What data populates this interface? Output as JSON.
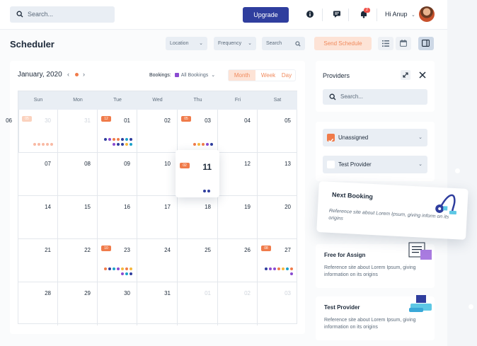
{
  "topbar": {
    "search_placeholder": "Search...",
    "upgrade_label": "Upgrade",
    "notification_count": "2",
    "greeting": "Hi Anup"
  },
  "page": {
    "title": "Scheduler",
    "filters": {
      "location": "Location",
      "frequency": "Frequency",
      "search": "Search"
    },
    "send_schedule_label": "Send Schedule"
  },
  "calendar": {
    "month_label": "January, 2020",
    "prev_icon": "chevron-left-icon",
    "next_icon": "chevron-right-icon",
    "bookings_label": "Bookings:",
    "bookings_value": "All Bookings",
    "view_tabs": [
      "Month",
      "Week",
      "Day"
    ],
    "active_view": "Month",
    "weekdays": [
      "Sun",
      "Mon",
      "Tue",
      "Wed",
      "Thu",
      "Fri",
      "Sat"
    ],
    "weeks": [
      [
        {
          "day": "30",
          "dim": true,
          "badge": "05",
          "dots": [
            "#f9b9a4",
            "#f9b9a4",
            "#f9b9a4",
            "#f9b9a4",
            "#f9b9a4"
          ]
        },
        {
          "day": "31",
          "dim": true
        },
        {
          "day": "01",
          "badge": "12",
          "dots": [
            "#2f3e9e",
            "#8a4bd1",
            "#f07b4a",
            "#f07b4a",
            "#2f3e9e",
            "#1aa1c9",
            "#2f3e9e",
            "#8a4bd1",
            "#2f3e9e",
            "#2f3e9e",
            "#f6b73c",
            "#1aa1c9"
          ]
        },
        {
          "day": "02"
        },
        {
          "day": "03",
          "badge": "05",
          "dots": [
            "#f07b4a",
            "#f6b73c",
            "#f07b4a",
            "#8a4bd1",
            "#2f3e9e"
          ]
        },
        {
          "day": "04"
        },
        {
          "day": "05"
        },
        {
          "day": "06"
        }
      ],
      [
        {
          "day": "07"
        },
        {
          "day": "08"
        },
        {
          "day": "09"
        },
        {
          "day": "10"
        },
        {
          "day": "11",
          "badge": "02",
          "dots": [
            "#2f3e9e",
            "#2f3e9e"
          ],
          "highlight": true
        },
        {
          "day": "12"
        },
        {
          "day": "13"
        }
      ],
      [
        {
          "day": "14"
        },
        {
          "day": "15"
        },
        {
          "day": "16"
        },
        {
          "day": "17"
        },
        {
          "day": "18"
        },
        {
          "day": "19"
        },
        {
          "day": "20"
        }
      ],
      [
        {
          "day": "21"
        },
        {
          "day": "22"
        },
        {
          "day": "23",
          "badge": "10",
          "dots": [
            "#f07b4a",
            "#2f3e9e",
            "#1aa1c9",
            "#8a4bd1",
            "#f6b73c",
            "#f07b4a",
            "#f6b73c",
            "#8a4bd1",
            "#1aa1c9",
            "#2f3e9e"
          ]
        },
        {
          "day": "24"
        },
        {
          "day": "25"
        },
        {
          "day": "26"
        },
        {
          "day": "27",
          "badge": "08",
          "dots": [
            "#2f3e9e",
            "#8a4bd1",
            "#8a4bd1",
            "#f07b4a",
            "#f6b73c",
            "#1aa1c9",
            "#f07b4a",
            "#8a4bd1"
          ]
        }
      ],
      [
        {
          "day": "28"
        },
        {
          "day": "29"
        },
        {
          "day": "30"
        },
        {
          "day": "31"
        },
        {
          "day": "01",
          "dim": true
        },
        {
          "day": "02",
          "dim": true
        },
        {
          "day": "03",
          "dim": true
        }
      ]
    ]
  },
  "providers": {
    "title": "Providers",
    "search_placeholder": "Search...",
    "items": [
      {
        "label": "Unassigned",
        "checked": true
      },
      {
        "label": "Test Provider",
        "checked": false
      }
    ]
  },
  "cards": {
    "next_booking": {
      "title": "Next Booking",
      "description": "Reference site about Lorem Ipsum, giving inform on its origins"
    },
    "free_for_assign": {
      "title": "Free for Assign",
      "description": "Reference site about Lorem Ipsum, giving information on its origins"
    },
    "test_provider": {
      "title": "Test Provider",
      "description": "Reference site about Lorem Ipsum, giving information on its origins"
    }
  },
  "colors": {
    "accent": "#f07b4a",
    "primary": "#2f3e9e",
    "soft_accent": "#fde3d6"
  }
}
